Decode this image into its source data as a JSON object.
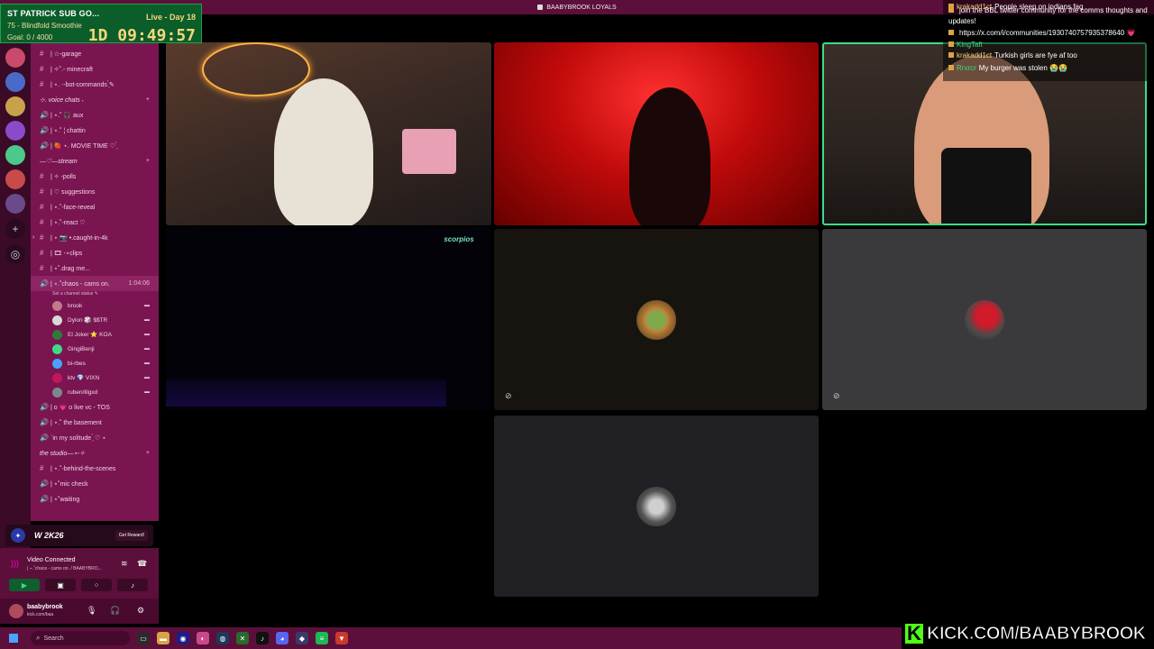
{
  "window": {
    "title": "BAABYBROOK LOYALS"
  },
  "overlay": {
    "title": "ST PATRICK SUB GO...",
    "subtitle": "75 - Blindfold Smoothie",
    "goal": "Goal: 0 / 4000",
    "live": "Live - Day 18",
    "timer": "1D 09:49:57"
  },
  "channels": {
    "items": [
      {
        "sym": "#",
        "label": "| ☆-garage"
      },
      {
        "sym": "#",
        "label": "| ✧˚.- minecraft"
      },
      {
        "sym": "#",
        "label": "| ⋆. ‧-bot-commands ̗̀✎"
      },
      {
        "category": "⊹. voice chats ˖",
        "plus": "+"
      },
      {
        "sym": "🔊",
        "label": "| ⋆.˚ 🎧 aux"
      },
      {
        "sym": "🔊",
        "label": "| ⋆.˚ ¦ chattin"
      },
      {
        "sym": "🔊",
        "label": "| 🍓 ⋆. MOVIE TIME ♡ ̗̀"
      },
      {
        "category": "—♡—stream",
        "plus": "+"
      },
      {
        "sym": "#",
        "label": "| ✧ -polls"
      },
      {
        "sym": "#",
        "label": "| ♡ suggestions"
      },
      {
        "sym": "#",
        "label": "| ⋆.˚-face-reveal"
      },
      {
        "sym": "#",
        "label": "| ⋆.˚-react ♡"
      },
      {
        "sym": "#",
        "label": "| ⋆ 📷 •.caught-in-4k",
        "arrow": "›"
      },
      {
        "sym": "#",
        "label": "| 🎞 -⋆clips"
      },
      {
        "sym": "#",
        "label": "| ⋆˚.drag me..."
      },
      {
        "sym": "🔊",
        "label": "| ⋆.˚chaos - cams on.",
        "extra": "1:04:06",
        "active": true
      }
    ],
    "status_hint": "Set a channel status ✎",
    "members": [
      {
        "name": "brook",
        "color": "#c27b8a"
      },
      {
        "name": "Dylon 🎲 $$TR",
        "color": "#d8d8d8"
      },
      {
        "name": "El Joker ⭐ KOA",
        "color": "#2d7a3a"
      },
      {
        "name": "GingiBenji",
        "color": "#3ddc84"
      },
      {
        "name": "bi-rbes",
        "color": "#4aa3ff"
      },
      {
        "name": "ktv 💎 VIXN",
        "color": "#c2185b"
      },
      {
        "name": "ruben/lilgxd",
        "color": "#7a8a8a"
      }
    ],
    "items_after": [
      {
        "sym": "🔊",
        "label": "| o 💗 o live vc - TOS"
      },
      {
        "sym": "🔊",
        "label": "| ⋆.˚ the basement"
      },
      {
        "sym": "🔊",
        "label": "ʾin my solitude ̗̀ ♡ ⋆"
      },
      {
        "category": "the studio—⋆-✧",
        "plus": "+"
      },
      {
        "sym": "#",
        "label": "| ⋆.˚-behind-the-scenes"
      },
      {
        "sym": "🔊",
        "label": "| ⋆˚mic check"
      },
      {
        "sym": "🔊",
        "label": "| ⋆˚waiting"
      }
    ]
  },
  "reward": {
    "game": "W 2K26",
    "button": "Get Reward!"
  },
  "voice": {
    "state": "Video Connected",
    "channel": "| ⋆.˚chaos - cams on. / BAABYBRO..."
  },
  "user": {
    "name": "baabybrook",
    "sub": "kick.com/baa"
  },
  "chat": {
    "messages": [
      {
        "user": "krakadd1ct",
        "text": "People sleep on indians fag",
        "ucolor": "#f5d77a"
      },
      {
        "user": "",
        "text": "join the BBL twitter community for the comms thoughts and updates!",
        "ucolor": "#ff4d6a"
      },
      {
        "user": "",
        "text": "https://x.com/i/communities/1930740757935378640 💗",
        "ucolor": "#fff"
      },
      {
        "user": "KingTaft",
        "text": "",
        "ucolor": "#3ddc84"
      },
      {
        "user": "krakadd1ct",
        "text": "Turkish girls are fye af too",
        "ucolor": "#f5d77a"
      },
      {
        "user": "Rrxrcr",
        "text": "My burger was stolen 😭😭",
        "ucolor": "#3ddc84"
      }
    ]
  },
  "tiles": {
    "logo_tile4": "scorpios"
  },
  "kick": {
    "logo": "K",
    "text": "KICK.COM/BAABYBROOK"
  },
  "taskbar": {
    "search": "Search"
  }
}
